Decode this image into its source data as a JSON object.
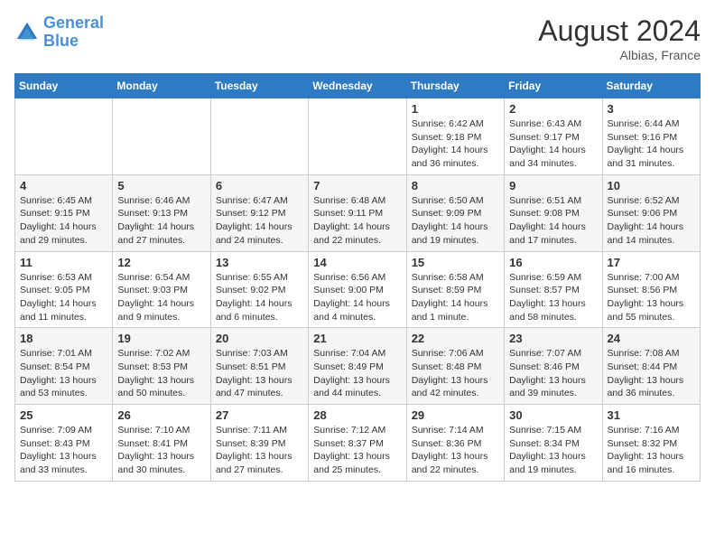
{
  "header": {
    "logo_line1": "General",
    "logo_line2": "Blue",
    "month_year": "August 2024",
    "location": "Albias, France"
  },
  "days_of_week": [
    "Sunday",
    "Monday",
    "Tuesday",
    "Wednesday",
    "Thursday",
    "Friday",
    "Saturday"
  ],
  "weeks": [
    [
      {
        "day": "",
        "info": ""
      },
      {
        "day": "",
        "info": ""
      },
      {
        "day": "",
        "info": ""
      },
      {
        "day": "",
        "info": ""
      },
      {
        "day": "1",
        "info": "Sunrise: 6:42 AM\nSunset: 9:18 PM\nDaylight: 14 hours and 36 minutes."
      },
      {
        "day": "2",
        "info": "Sunrise: 6:43 AM\nSunset: 9:17 PM\nDaylight: 14 hours and 34 minutes."
      },
      {
        "day": "3",
        "info": "Sunrise: 6:44 AM\nSunset: 9:16 PM\nDaylight: 14 hours and 31 minutes."
      }
    ],
    [
      {
        "day": "4",
        "info": "Sunrise: 6:45 AM\nSunset: 9:15 PM\nDaylight: 14 hours and 29 minutes."
      },
      {
        "day": "5",
        "info": "Sunrise: 6:46 AM\nSunset: 9:13 PM\nDaylight: 14 hours and 27 minutes."
      },
      {
        "day": "6",
        "info": "Sunrise: 6:47 AM\nSunset: 9:12 PM\nDaylight: 14 hours and 24 minutes."
      },
      {
        "day": "7",
        "info": "Sunrise: 6:48 AM\nSunset: 9:11 PM\nDaylight: 14 hours and 22 minutes."
      },
      {
        "day": "8",
        "info": "Sunrise: 6:50 AM\nSunset: 9:09 PM\nDaylight: 14 hours and 19 minutes."
      },
      {
        "day": "9",
        "info": "Sunrise: 6:51 AM\nSunset: 9:08 PM\nDaylight: 14 hours and 17 minutes."
      },
      {
        "day": "10",
        "info": "Sunrise: 6:52 AM\nSunset: 9:06 PM\nDaylight: 14 hours and 14 minutes."
      }
    ],
    [
      {
        "day": "11",
        "info": "Sunrise: 6:53 AM\nSunset: 9:05 PM\nDaylight: 14 hours and 11 minutes."
      },
      {
        "day": "12",
        "info": "Sunrise: 6:54 AM\nSunset: 9:03 PM\nDaylight: 14 hours and 9 minutes."
      },
      {
        "day": "13",
        "info": "Sunrise: 6:55 AM\nSunset: 9:02 PM\nDaylight: 14 hours and 6 minutes."
      },
      {
        "day": "14",
        "info": "Sunrise: 6:56 AM\nSunset: 9:00 PM\nDaylight: 14 hours and 4 minutes."
      },
      {
        "day": "15",
        "info": "Sunrise: 6:58 AM\nSunset: 8:59 PM\nDaylight: 14 hours and 1 minute."
      },
      {
        "day": "16",
        "info": "Sunrise: 6:59 AM\nSunset: 8:57 PM\nDaylight: 13 hours and 58 minutes."
      },
      {
        "day": "17",
        "info": "Sunrise: 7:00 AM\nSunset: 8:56 PM\nDaylight: 13 hours and 55 minutes."
      }
    ],
    [
      {
        "day": "18",
        "info": "Sunrise: 7:01 AM\nSunset: 8:54 PM\nDaylight: 13 hours and 53 minutes."
      },
      {
        "day": "19",
        "info": "Sunrise: 7:02 AM\nSunset: 8:53 PM\nDaylight: 13 hours and 50 minutes."
      },
      {
        "day": "20",
        "info": "Sunrise: 7:03 AM\nSunset: 8:51 PM\nDaylight: 13 hours and 47 minutes."
      },
      {
        "day": "21",
        "info": "Sunrise: 7:04 AM\nSunset: 8:49 PM\nDaylight: 13 hours and 44 minutes."
      },
      {
        "day": "22",
        "info": "Sunrise: 7:06 AM\nSunset: 8:48 PM\nDaylight: 13 hours and 42 minutes."
      },
      {
        "day": "23",
        "info": "Sunrise: 7:07 AM\nSunset: 8:46 PM\nDaylight: 13 hours and 39 minutes."
      },
      {
        "day": "24",
        "info": "Sunrise: 7:08 AM\nSunset: 8:44 PM\nDaylight: 13 hours and 36 minutes."
      }
    ],
    [
      {
        "day": "25",
        "info": "Sunrise: 7:09 AM\nSunset: 8:43 PM\nDaylight: 13 hours and 33 minutes."
      },
      {
        "day": "26",
        "info": "Sunrise: 7:10 AM\nSunset: 8:41 PM\nDaylight: 13 hours and 30 minutes."
      },
      {
        "day": "27",
        "info": "Sunrise: 7:11 AM\nSunset: 8:39 PM\nDaylight: 13 hours and 27 minutes."
      },
      {
        "day": "28",
        "info": "Sunrise: 7:12 AM\nSunset: 8:37 PM\nDaylight: 13 hours and 25 minutes."
      },
      {
        "day": "29",
        "info": "Sunrise: 7:14 AM\nSunset: 8:36 PM\nDaylight: 13 hours and 22 minutes."
      },
      {
        "day": "30",
        "info": "Sunrise: 7:15 AM\nSunset: 8:34 PM\nDaylight: 13 hours and 19 minutes."
      },
      {
        "day": "31",
        "info": "Sunrise: 7:16 AM\nSunset: 8:32 PM\nDaylight: 13 hours and 16 minutes."
      }
    ]
  ]
}
